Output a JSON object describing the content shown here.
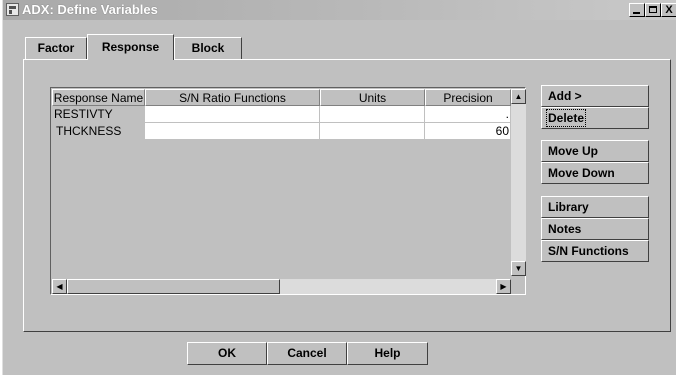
{
  "window": {
    "title": "ADX: Define Variables"
  },
  "title_buttons": {
    "minimize": "_",
    "maximize": "□",
    "close": "X"
  },
  "tabs": [
    {
      "label": "Factor",
      "active": false
    },
    {
      "label": "Response",
      "active": true
    },
    {
      "label": "Block",
      "active": false
    }
  ],
  "grid": {
    "columns": [
      "Response Name",
      "S/N Ratio Functions",
      "Units",
      "Precision"
    ],
    "rows": [
      {
        "name": "RESTIVTY",
        "sn": "",
        "units": "",
        "precision": "."
      },
      {
        "name": "THCKNESS",
        "sn": "",
        "units": "",
        "precision": "60"
      }
    ]
  },
  "side_buttons": {
    "add": "Add >",
    "delete": "Delete",
    "move_up": "Move Up",
    "move_down": "Move Down",
    "library": "Library",
    "notes": "Notes",
    "sn_functions": "S/N Functions"
  },
  "bottom_buttons": {
    "ok": "OK",
    "cancel": "Cancel",
    "help": "Help"
  },
  "icons": {
    "app": "adx-app-icon",
    "scroll_up": "arrow-up-icon",
    "scroll_down": "arrow-down-icon",
    "scroll_left": "arrow-left-icon",
    "scroll_right": "arrow-right-icon"
  }
}
